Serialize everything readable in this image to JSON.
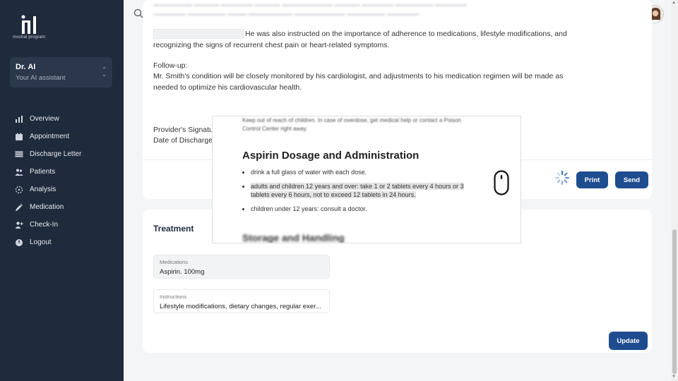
{
  "brand": {
    "name": "moshal program",
    "icon": "moshal-logo"
  },
  "assistant": {
    "name": "Dr. AI",
    "subtitle": "Your AI assistant"
  },
  "nav": [
    {
      "label": "Overview",
      "icon": "bar-chart-icon"
    },
    {
      "label": "Appointment",
      "icon": "calendar-icon"
    },
    {
      "label": "Discharge Letter",
      "icon": "table-icon"
    },
    {
      "label": "Patients",
      "icon": "users-icon"
    },
    {
      "label": "Analysis",
      "icon": "dashed-circle-icon"
    },
    {
      "label": "Medication",
      "icon": "syringe-icon"
    },
    {
      "label": "Check-In",
      "icon": "user-plus-icon"
    },
    {
      "label": "Logout",
      "icon": "power-icon"
    }
  ],
  "letter": {
    "line1": "He was also instructed on the importance of adherence to medications, lifestyle modifications, and recognizing the signs of recurrent chest pain or heart-related symptoms.",
    "followup_heading": "Follow-up:",
    "followup_text": "Mr. Smith's condition will be closely monitored by his cardiologist, and adjustments to his medication regimen will be made as needed to optimize his cardiovascular health.",
    "provider_label": "Provider's Signatu",
    "date_label": "Date of Discharge"
  },
  "actions": {
    "print": "Print",
    "send": "Send",
    "update": "Update"
  },
  "treatment": {
    "title": "Treatment",
    "medications_label": "Medications",
    "medications_value": "Aspirin. 100mg",
    "instructions_label": "Instructions",
    "instructions_value": "Lifestyle modifications, dietary changes, regular exer..."
  },
  "popup": {
    "top_snippet": "Keep out of reach of children. In case of overdose, get medical help or contact a Poison Control Center right away.",
    "title": "Aspirin Dosage and Administration",
    "items": [
      "drink a full glass of water with each dose.",
      "adults and children 12 years and over: take 1 or 2 tablets every 4 hours or 3 tablets every 6 hours, not to exceed 12 tablets in 24 hours.",
      "children under 12 years: consult a doctor."
    ],
    "bottom_heading": "Storage and Handling"
  },
  "colors": {
    "sidebar": "#1f2a3c",
    "primary": "#1e4d8f"
  }
}
